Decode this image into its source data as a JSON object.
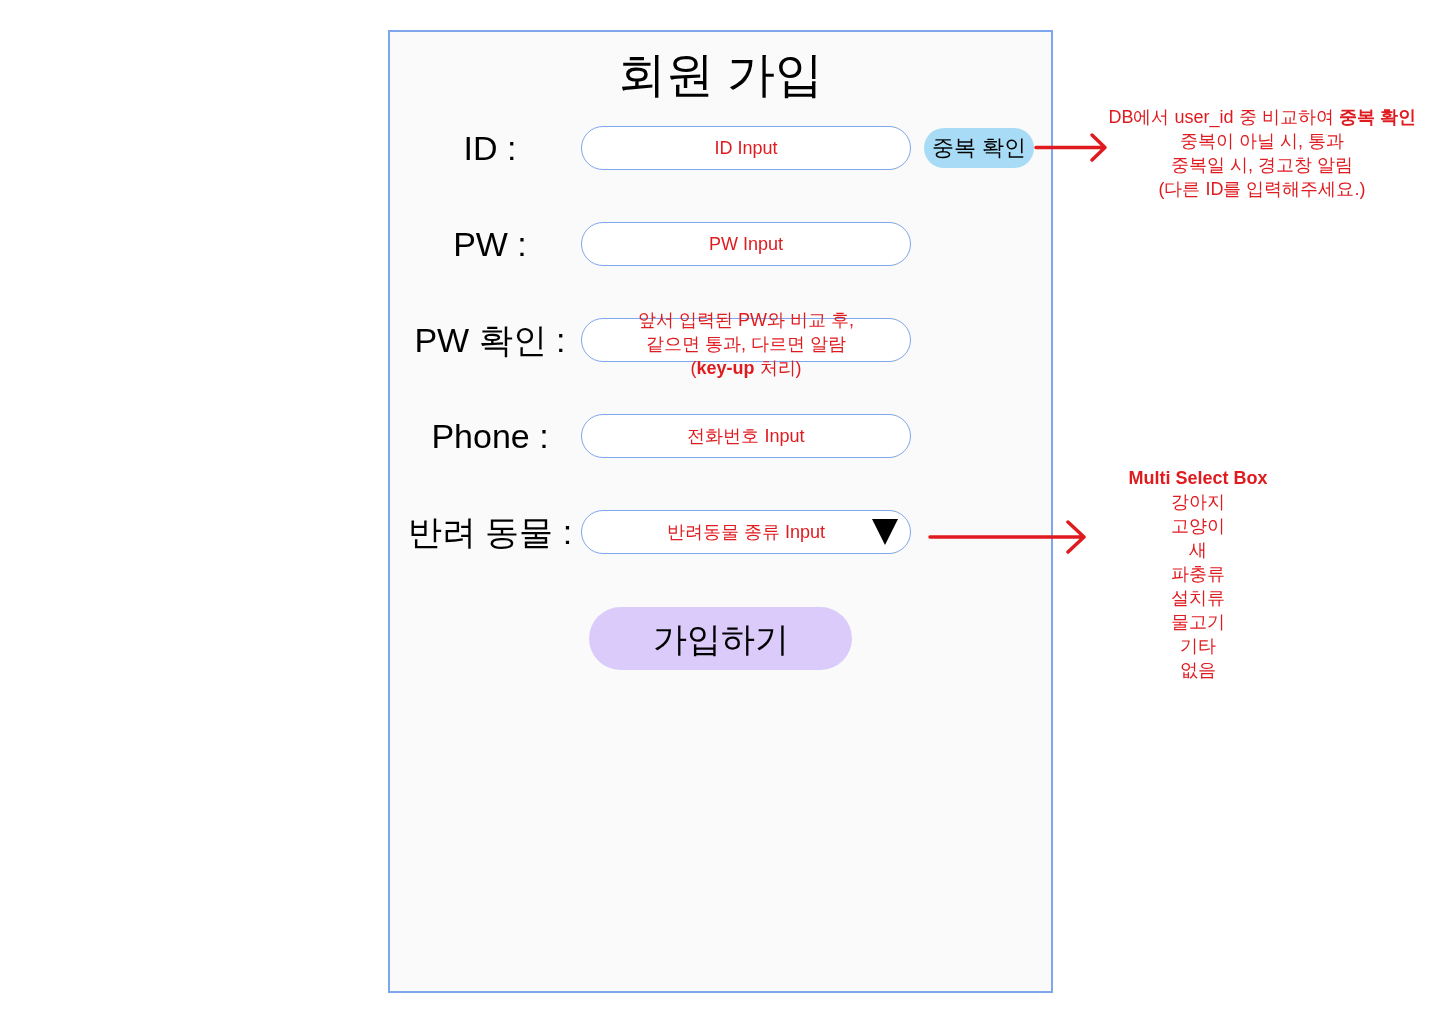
{
  "title": "회원 가입",
  "fields": [
    {
      "kind": "text",
      "label": "ID :",
      "placeholder": "ID Input",
      "button": "중복 확인"
    },
    {
      "kind": "text",
      "label": "PW :",
      "placeholder": "PW Input"
    },
    {
      "kind": "note",
      "label": "PW 확인 :",
      "note_lines": [
        "앞서 입력된 PW와 비교 후,",
        "같으면 통과, 다르면 알람",
        "(**key-up** 처리)"
      ]
    },
    {
      "kind": "text",
      "label": "Phone :",
      "placeholder": "전화번호 Input"
    },
    {
      "kind": "select",
      "label": "반려 동물 :",
      "placeholder": "반려동물 종류 Input"
    }
  ],
  "submit_button": "가입하기",
  "annotations": [
    {
      "kind": "note",
      "lines": [
        "DB에서 user_id 중 비교하여 **중복 확인**",
        "중복이 아닐 시, 통과",
        "중복일 시, 경고창 알림",
        "(다른 ID를 입력해주세요.)"
      ]
    },
    {
      "kind": "options",
      "heading": "Multi Select Box",
      "options": [
        "강아지",
        "고양이",
        "새",
        "파충류",
        "설치류",
        "물고기",
        "기타",
        "없음"
      ]
    }
  ]
}
